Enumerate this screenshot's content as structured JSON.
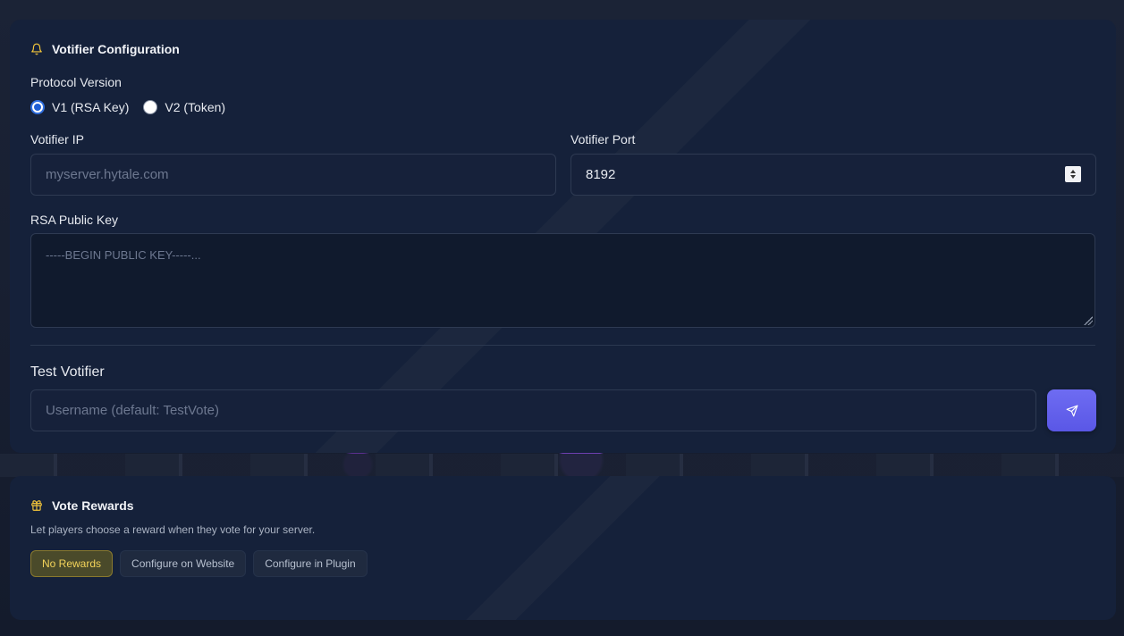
{
  "votifier": {
    "title": "Votifier Configuration",
    "protocol_label": "Protocol Version",
    "protocol_options": [
      {
        "label": "V1 (RSA Key)",
        "selected": true
      },
      {
        "label": "V2 (Token)",
        "selected": false
      }
    ],
    "ip_label": "Votifier IP",
    "ip_placeholder": "myserver.hytale.com",
    "port_label": "Votifier Port",
    "port_value": "8192",
    "rsa_label": "RSA Public Key",
    "rsa_placeholder": "-----BEGIN PUBLIC KEY-----...",
    "test_label": "Test Votifier",
    "test_placeholder": "Username (default: TestVote)"
  },
  "rewards": {
    "title": "Vote Rewards",
    "description": "Let players choose a reward when they vote for your server.",
    "options": [
      {
        "label": "No Rewards",
        "active": true
      },
      {
        "label": "Configure on Website",
        "active": false
      },
      {
        "label": "Configure in Plugin",
        "active": false
      }
    ]
  },
  "icons": {
    "votifier_title": "bell-icon",
    "rewards_title": "gift-icon",
    "send": "send-icon"
  },
  "colors": {
    "accent_yellow": "#f3c53a",
    "send_button": "#6360ec",
    "radio_checked": "#1f5fd6"
  }
}
